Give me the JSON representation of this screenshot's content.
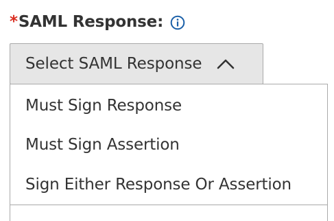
{
  "field": {
    "required_mark": "*",
    "label": "SAML Response:",
    "info_icon": "info-circle-icon"
  },
  "select": {
    "selected_label": "Select SAML Response",
    "chevron_icon": "chevron-up-icon",
    "expanded": true
  },
  "options": [
    {
      "label": "Must Sign Response"
    },
    {
      "label": "Must Sign Assertion"
    },
    {
      "label": "Sign Either Response Or Assertion"
    }
  ],
  "colors": {
    "required": "#d92d20",
    "info_icon": "#1a5fa8",
    "trigger_background": "#e6e6e6",
    "border": "#a9a9a9",
    "text": "#333333"
  }
}
